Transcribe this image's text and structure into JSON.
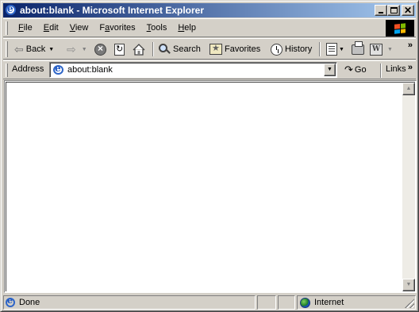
{
  "window": {
    "title": "about:blank - Microsoft Internet Explorer"
  },
  "menu": {
    "items": [
      {
        "label": "File",
        "hotkey": "F"
      },
      {
        "label": "Edit",
        "hotkey": "E"
      },
      {
        "label": "View",
        "hotkey": "V"
      },
      {
        "label": "Favorites",
        "hotkey": "a"
      },
      {
        "label": "Tools",
        "hotkey": "T"
      },
      {
        "label": "Help",
        "hotkey": "H"
      }
    ]
  },
  "toolbar": {
    "back_label": "Back",
    "search_label": "Search",
    "favorites_label": "Favorites",
    "history_label": "History",
    "more_chevron": "»"
  },
  "address": {
    "label": "Address",
    "value": "about:blank",
    "go_label": "Go",
    "links_label": "Links",
    "links_chevron": "»"
  },
  "status": {
    "text": "Done",
    "zone": "Internet"
  },
  "icons": {
    "page": "ie-page-icon",
    "zone": "globe-icon"
  }
}
